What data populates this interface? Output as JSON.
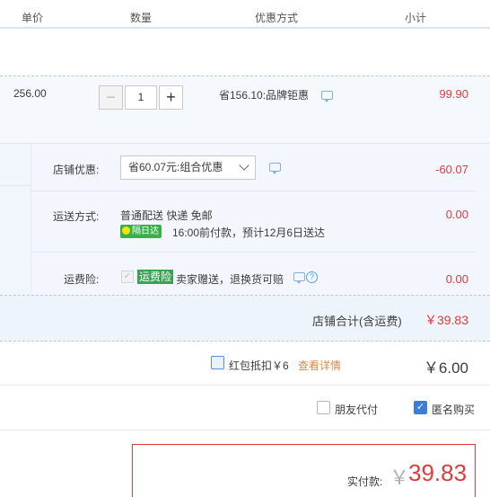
{
  "header": {
    "col_price": "单价",
    "col_qty": "数量",
    "col_discount": "优惠方式",
    "col_subtotal": "小计"
  },
  "item": {
    "unit_price": "256.00",
    "qty_minus": "−",
    "quantity": "1",
    "qty_plus": "+",
    "promo": "省156.10:品牌钜惠",
    "subtotal": "99.90"
  },
  "shop": {
    "discount_label": "店铺优惠:",
    "discount_selected": "省60.07元:组合优惠",
    "discount_value": "-60.07",
    "shipping_label": "运送方式:",
    "shipping_method": "普通配送 快递 免邮",
    "next_day_badge": "隔日达",
    "delivery_note": "16:00前付款，预计12月6日送达",
    "shipping_value": "0.00",
    "insurance_label": "运费险:",
    "insurance_badge": "运费险",
    "insurance_desc": "卖家赠送，退换货可赔",
    "insurance_value": "0.00",
    "total_label": "店铺合计(含运费)",
    "total_value": "￥39.83"
  },
  "red_packet": {
    "label": "红包抵扣￥6",
    "link": "查看详情",
    "amount": "￥6.00"
  },
  "options": {
    "friend_pay": "朋友代付",
    "anonymous": "匿名购买"
  },
  "payment": {
    "label": "实付款:",
    "currency": "￥",
    "amount": "39.83"
  },
  "colors": {
    "accent_red": "#e4393c",
    "link_orange": "#d7884e",
    "badge_green": "#37b24a",
    "checkbox_blue": "#3d7ed9"
  }
}
